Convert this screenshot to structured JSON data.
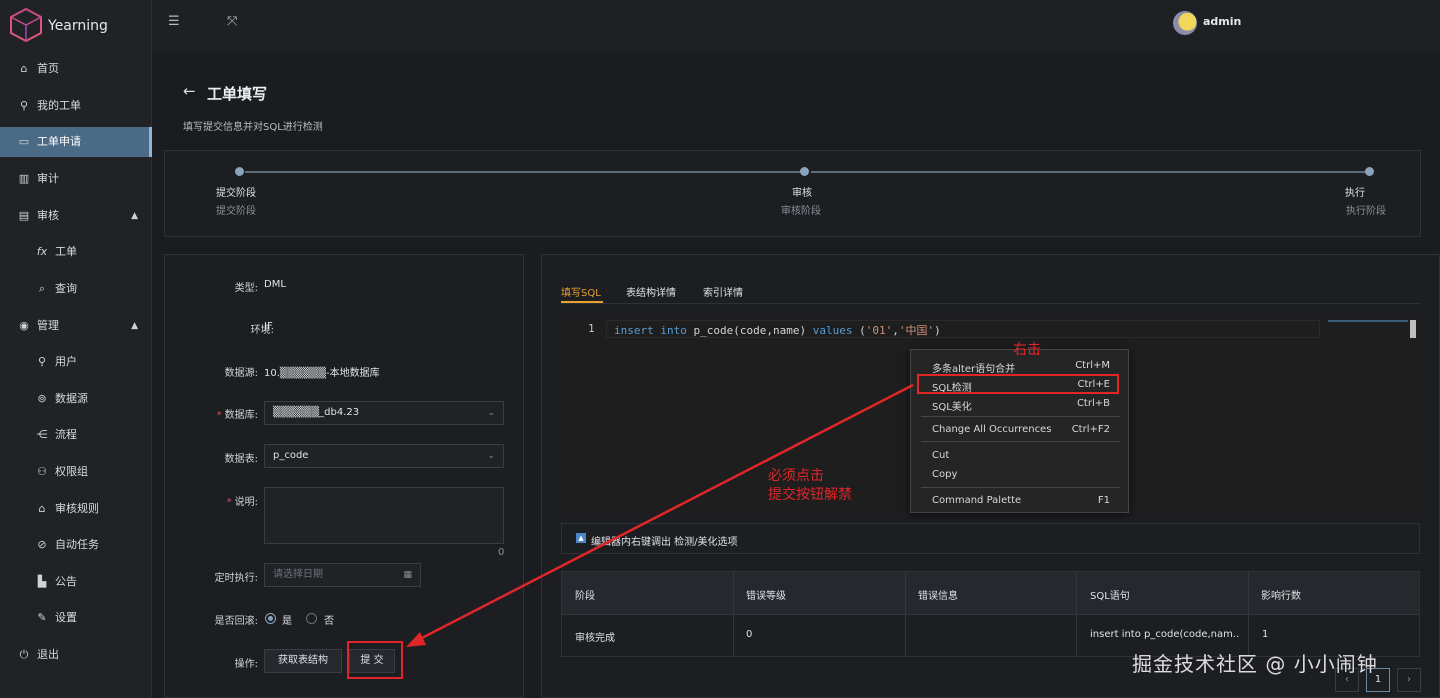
{
  "app": {
    "name": "Yearning"
  },
  "user": {
    "name": "admin"
  },
  "sidebar": {
    "items": [
      {
        "label": "首页",
        "icon": "home-icon"
      },
      {
        "label": "我的工单",
        "icon": "user-icon"
      },
      {
        "label": "工单申请",
        "icon": "form-icon",
        "active": true
      },
      {
        "label": "审计",
        "icon": "chart-icon"
      },
      {
        "label": "审核",
        "icon": "audit-icon"
      },
      {
        "label": "工单",
        "icon": "fx-icon"
      },
      {
        "label": "查询",
        "icon": "search-icon"
      },
      {
        "label": "管理",
        "icon": "eye-icon"
      },
      {
        "label": "用户",
        "icon": "user-icon"
      },
      {
        "label": "数据源",
        "icon": "datasource-icon"
      },
      {
        "label": "流程",
        "icon": "flow-icon"
      },
      {
        "label": "权限组",
        "icon": "group-icon"
      },
      {
        "label": "审核规则",
        "icon": "rule-icon"
      },
      {
        "label": "自动任务",
        "icon": "task-icon"
      },
      {
        "label": "公告",
        "icon": "notice-icon"
      },
      {
        "label": "设置",
        "icon": "settings-icon"
      },
      {
        "label": "退出",
        "icon": "logout-icon"
      }
    ]
  },
  "page": {
    "title": "工单填写",
    "subtitle": "填写提交信息并对SQL进行检测"
  },
  "steps": [
    {
      "title": "提交阶段",
      "desc": "提交阶段"
    },
    {
      "title": "审核",
      "desc": "审核阶段"
    },
    {
      "title": "执行",
      "desc": "执行阶段"
    }
  ],
  "form": {
    "type_label": "类型:",
    "type_value": "DML",
    "env_label": "环境:",
    "env_value": "JF",
    "source_label": "数据源:",
    "source_value": "10.▒▒▒▒▒▒-本地数据库",
    "db_label": "数据库:",
    "db_value": "▒▒▒▒▒▒_db4.23",
    "table_label": "数据表:",
    "table_value": "p_code",
    "desc_label": "说明:",
    "desc_count": "0",
    "schedule_label": "定时执行:",
    "schedule_placeholder": "请选择日期",
    "rollback_label": "是否回滚:",
    "rollback_yes": "是",
    "rollback_no": "否",
    "rollback_selected": "是",
    "action_label": "操作:",
    "fetch_button": "获取表结构",
    "submit_button": "提 交",
    "required_mark": "*"
  },
  "editor": {
    "tabs": [
      "填写SQL",
      "表结构详情",
      "索引详情"
    ],
    "active_tab": "填写SQL",
    "line_number": "1",
    "code_kw1": "insert into",
    "code_mid": " p_code(code,name) ",
    "code_kw2": "values",
    "code_open": " (",
    "code_str1": "'01'",
    "code_comma": ",",
    "code_str2": "'中国'",
    "code_close": ")"
  },
  "context_menu": [
    {
      "label": "多条alter语句合并",
      "shortcut": "Ctrl+M"
    },
    {
      "label": "SQL检测",
      "shortcut": "Ctrl+E"
    },
    {
      "label": "SQL美化",
      "shortcut": "Ctrl+B"
    },
    {
      "label": "Change All Occurrences",
      "shortcut": "Ctrl+F2"
    },
    {
      "label": "Cut",
      "shortcut": ""
    },
    {
      "label": "Copy",
      "shortcut": ""
    },
    {
      "label": "Command Palette",
      "shortcut": "F1"
    }
  ],
  "annotations": {
    "right_click": "右击",
    "must_click_1": "必须点击",
    "must_click_2": "提交按钮解禁"
  },
  "options": {
    "text": "编辑器内右键调出 检测/美化选项"
  },
  "result_table": {
    "headers": [
      "阶段",
      "错误等级",
      "错误信息",
      "SQL语句",
      "影响行数"
    ],
    "rows": [
      [
        "审核完成",
        "0",
        "",
        "insert into p_code(code,nam...",
        "1"
      ]
    ]
  },
  "pagination": {
    "prev": "‹",
    "current": "1",
    "next": "›"
  },
  "watermark": "掘金技术社区 @ 小小闹钟",
  "colors": {
    "accent": "#e8a230",
    "active_menu": "#4a6a86",
    "annotation": "#e1262a"
  }
}
